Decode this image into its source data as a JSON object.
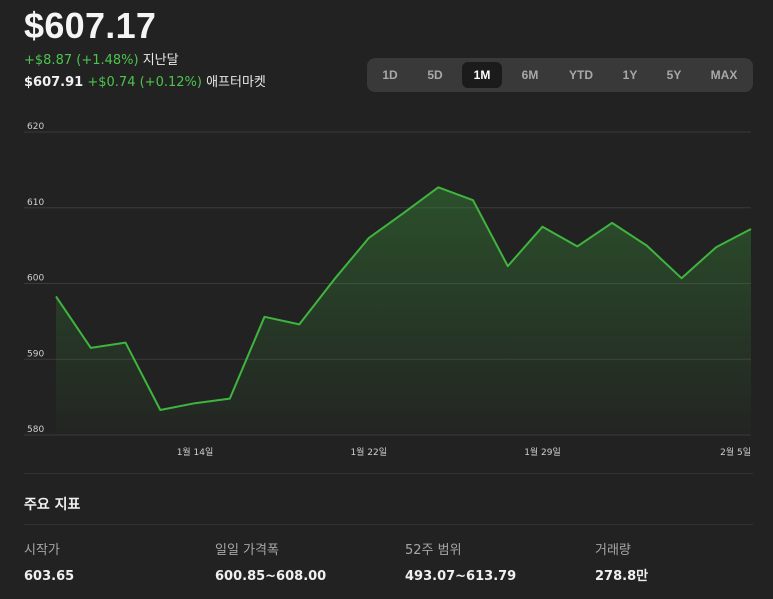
{
  "header": {
    "price": "$607.17",
    "change": "+$8.87 (+1.48%)",
    "change_period": "지난달",
    "after_price": "$607.91",
    "after_change": "+$0.74 (+0.12%)",
    "after_label": "애프터마켓"
  },
  "ranges": {
    "selected": "1M",
    "options": [
      {
        "label": "1D"
      },
      {
        "label": "5D"
      },
      {
        "label": "1M"
      },
      {
        "label": "6M"
      },
      {
        "label": "YTD"
      },
      {
        "label": "1Y"
      },
      {
        "label": "5Y"
      },
      {
        "label": "MAX"
      }
    ]
  },
  "chart_data": {
    "type": "area",
    "title": "",
    "xlabel": "",
    "ylabel": "",
    "ylim": [
      580,
      620
    ],
    "yticks": [
      580,
      590,
      600,
      610,
      620
    ],
    "x_ticks": [
      {
        "label": "1월 14일",
        "index": 4
      },
      {
        "label": "1월 22일",
        "index": 9
      },
      {
        "label": "1월 29일",
        "index": 14
      },
      {
        "label": "2월 5일",
        "index": 19
      }
    ],
    "series": [
      {
        "values": [
          598.3,
          591.5,
          592.2,
          583.3,
          584.2,
          584.8,
          595.6,
          594.6,
          600.5,
          606.0,
          609.3,
          612.7,
          611.0,
          602.3,
          607.5,
          604.9,
          608.0,
          605.0,
          600.7,
          604.8,
          607.2
        ]
      }
    ],
    "grid": true,
    "colors": {
      "line": "#3fb53f",
      "fill": "#3a9a3a",
      "grid": "#3a3a3a",
      "tick_label": "#cfcfcf"
    }
  },
  "key_stats": {
    "title": "주요 지표",
    "items": [
      {
        "label": "시작가",
        "value": "603.65"
      },
      {
        "label": "일일 가격폭",
        "value": "600.85~608.00"
      },
      {
        "label": "52주 범위",
        "value": "493.07~613.79"
      },
      {
        "label": "거래량",
        "value": "278.8만"
      }
    ]
  }
}
